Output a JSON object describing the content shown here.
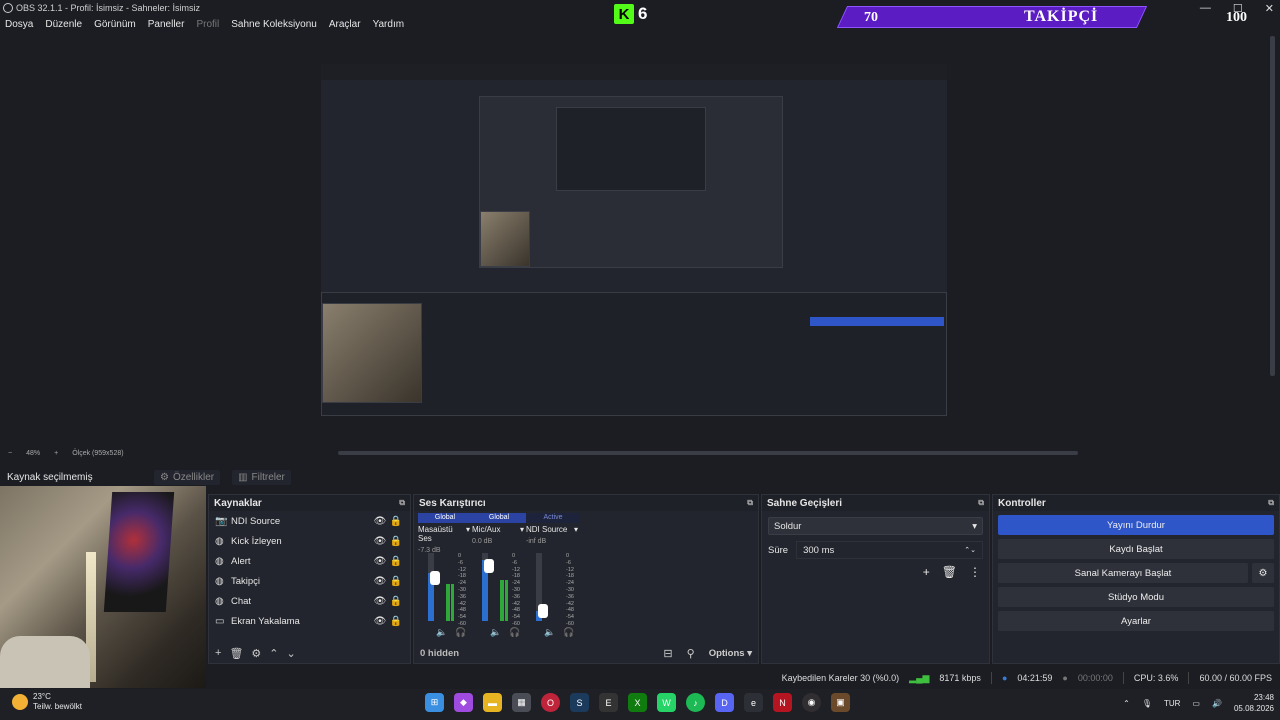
{
  "window": {
    "title": "OBS 32.1.1 - Profil: İsimsiz - Sahneler: İsimsiz",
    "controls": [
      "—",
      "☐",
      "✕"
    ]
  },
  "menu": [
    "Dosya",
    "Düzenle",
    "Görünüm",
    "Paneller",
    "Profil",
    "Sahne Koleksiyonu",
    "Araçlar",
    "Yardım"
  ],
  "overlay": {
    "kick_letter": "K",
    "kick_number": "6",
    "follow_current": "70",
    "follow_label": "TAKİPÇİ",
    "follow_goal": "100"
  },
  "zoom": {
    "minus": "−",
    "percent": "48%",
    "plus": "+",
    "scale": "Ölçek (959x528)"
  },
  "selection": {
    "label": "Kaynak seçilmemiş",
    "properties": "Özellikler",
    "filters": "Filtreler"
  },
  "sources": {
    "title": "Kaynaklar",
    "items": [
      {
        "name": "NDI Source",
        "icon": "camera-icon"
      },
      {
        "name": "Kick İzleyen",
        "icon": "globe-icon"
      },
      {
        "name": "Alert",
        "icon": "globe-icon"
      },
      {
        "name": "Takipçi",
        "icon": "globe-icon"
      },
      {
        "name": "Chat",
        "icon": "globe-icon"
      },
      {
        "name": "Ekran Yakalama",
        "icon": "monitor-icon"
      }
    ]
  },
  "mixer": {
    "title": "Ses Karıştırıcı",
    "channels": [
      {
        "tag": "Global",
        "name": "Masaüstü Ses",
        "db": "-7.3 dB",
        "level": 0.55,
        "knob": 0.7
      },
      {
        "tag": "Global",
        "name": "Mic/Aux",
        "db": "0.0 dB",
        "level": 0.6,
        "knob": 0.9
      },
      {
        "tag": "Active",
        "name": "NDI Source",
        "db": "-inf dB",
        "level": 0.0,
        "knob": 0.15
      }
    ],
    "scale": [
      "0",
      "-6",
      "-12",
      "-18",
      "-24",
      "-30",
      "-36",
      "-42",
      "-48",
      "-54",
      "-60"
    ],
    "hidden": "0 hidden",
    "options": "Options"
  },
  "transitions": {
    "title": "Sahne Geçişleri",
    "selected": "Soldur",
    "duration_label": "Süre",
    "duration": "300 ms"
  },
  "controls": {
    "title": "Kontroller",
    "stream": "Yayını Durdur",
    "record": "Kaydı Başlat",
    "vcam": "Sanal Kamerayı Başlat",
    "studio": "Stüdyo Modu",
    "settings": "Ayarlar"
  },
  "status": {
    "dropped": "Kaybedilen Kareler 30 (%0.0)",
    "bitrate": "8171 kbps",
    "stream_time": "04:21:59",
    "rec_time": "00:00:00",
    "cpu": "CPU: 3.6%",
    "fps": "60.00 / 60.00 FPS"
  },
  "taskbar": {
    "temp": "23°C",
    "weather": "Teilw. bewölkt",
    "lang": "TUR",
    "time": "23:48",
    "date": "05.08.2026"
  },
  "colors": {
    "accent": "#2e56c9",
    "kick": "#53fc18",
    "banner": "#5b1cc4"
  }
}
